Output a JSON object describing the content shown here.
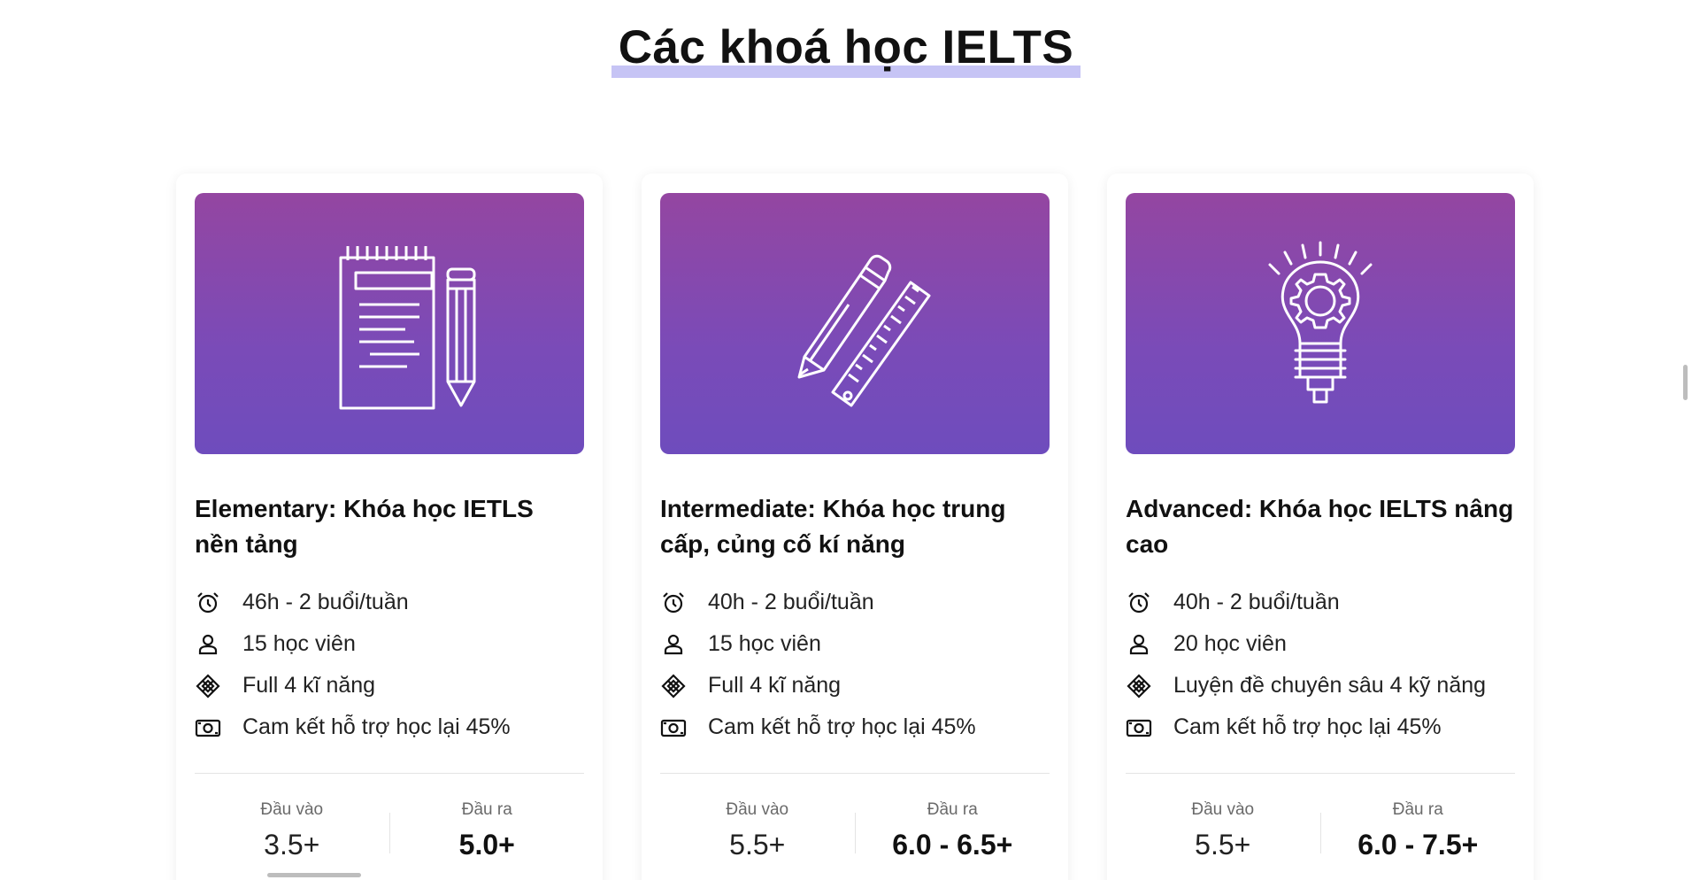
{
  "section": {
    "title": "Các khoá học IELTS",
    "accent_color": "#c6c4f5"
  },
  "cards": [
    {
      "image_icon": "notepad-pencil-icon",
      "title": "Elementary: Khóa học IETLS nền tảng",
      "features": [
        {
          "icon": "alarm-clock-icon",
          "text": "46h - 2 buổi/tuần"
        },
        {
          "icon": "user-icon",
          "text": "15 học viên"
        },
        {
          "icon": "diamond-grid-icon",
          "text": "Full 4 kĩ năng"
        },
        {
          "icon": "money-icon",
          "text": "Cam kết hỗ trợ học lại 45%"
        }
      ],
      "input_label": "Đầu vào",
      "input_value": "3.5+",
      "output_label": "Đầu ra",
      "output_value": "5.0+"
    },
    {
      "image_icon": "pencil-ruler-icon",
      "title": "Intermediate: Khóa học trung cấp, củng cố kí năng",
      "features": [
        {
          "icon": "alarm-clock-icon",
          "text": "40h - 2 buổi/tuần"
        },
        {
          "icon": "user-icon",
          "text": "15 học viên"
        },
        {
          "icon": "diamond-grid-icon",
          "text": "Full 4 kĩ năng"
        },
        {
          "icon": "money-icon",
          "text": "Cam kết hỗ trợ học lại 45%"
        }
      ],
      "input_label": "Đầu vào",
      "input_value": "5.5+",
      "output_label": "Đầu ra",
      "output_value": "6.0 - 6.5+"
    },
    {
      "image_icon": "lightbulb-gear-icon",
      "title": "Advanced: Khóa học IELTS nâng cao",
      "features": [
        {
          "icon": "alarm-clock-icon",
          "text": "40h - 2 buổi/tuần"
        },
        {
          "icon": "user-icon",
          "text": "20 học viên"
        },
        {
          "icon": "diamond-grid-icon",
          "text": "Luyện đề chuyên sâu 4 kỹ năng"
        },
        {
          "icon": "money-icon",
          "text": "Cam kết hỗ trợ học lại 45%"
        }
      ],
      "input_label": "Đầu vào",
      "input_value": "5.5+",
      "output_label": "Đầu ra",
      "output_value": "6.0 - 7.5+"
    }
  ],
  "colors": {
    "card_gradient_top": "#9446a1",
    "card_gradient_bottom": "#6e4cbd"
  }
}
